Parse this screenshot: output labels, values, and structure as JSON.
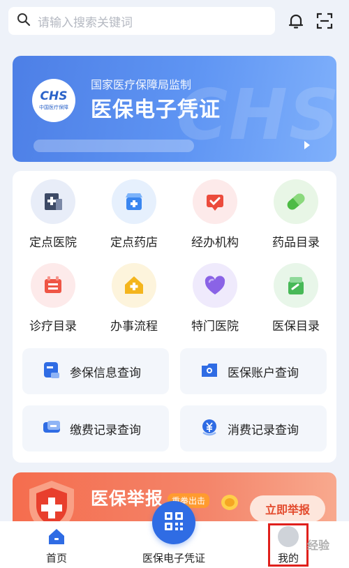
{
  "search": {
    "placeholder": "请输入搜索关键词"
  },
  "banner": {
    "supervision": "国家医疗保障局监制",
    "title": "医保电子凭证",
    "logo_text": "CHS",
    "logo_subtext": "中国医疗保障",
    "watermark_text": "CHS"
  },
  "services": [
    {
      "label": "定点医院",
      "icon": "hospital-icon",
      "color": "#3d4a66",
      "bg": "#e8edf8"
    },
    {
      "label": "定点药店",
      "icon": "pharmacy-icon",
      "color": "#3a86f0",
      "bg": "#e6f0fd"
    },
    {
      "label": "经办机构",
      "icon": "agency-icon",
      "color": "#ec4b3c",
      "bg": "#fdeaea"
    },
    {
      "label": "药品目录",
      "icon": "pill-icon",
      "color": "#4dbb45",
      "bg": "#e8f6e6"
    },
    {
      "label": "诊疗目录",
      "icon": "treatment-icon",
      "color": "#ef5545",
      "bg": "#fdeaea"
    },
    {
      "label": "办事流程",
      "icon": "process-icon",
      "color": "#f4b51d",
      "bg": "#fdf4dc"
    },
    {
      "label": "特门医院",
      "icon": "heart-icon",
      "color": "#8a63e6",
      "bg": "#efeafc"
    },
    {
      "label": "医保目录",
      "icon": "catalog-icon",
      "color": "#47b957",
      "bg": "#e8f6e9"
    }
  ],
  "queries": [
    {
      "label": "参保信息查询",
      "icon": "insured-info-icon"
    },
    {
      "label": "医保账户查询",
      "icon": "account-icon"
    },
    {
      "label": "缴费记录查询",
      "icon": "payment-record-icon"
    },
    {
      "label": "消费记录查询",
      "icon": "consumption-record-icon"
    }
  ],
  "report": {
    "title": "医保举报",
    "tag": "重拳出击",
    "button": "立即举报"
  },
  "nav": {
    "home": "首页",
    "voucher": "医保电子凭证",
    "mine": "我的"
  },
  "site_watermark": "经验",
  "colors": {
    "primary": "#2f6ce4",
    "highlight_border": "#e0201c"
  }
}
